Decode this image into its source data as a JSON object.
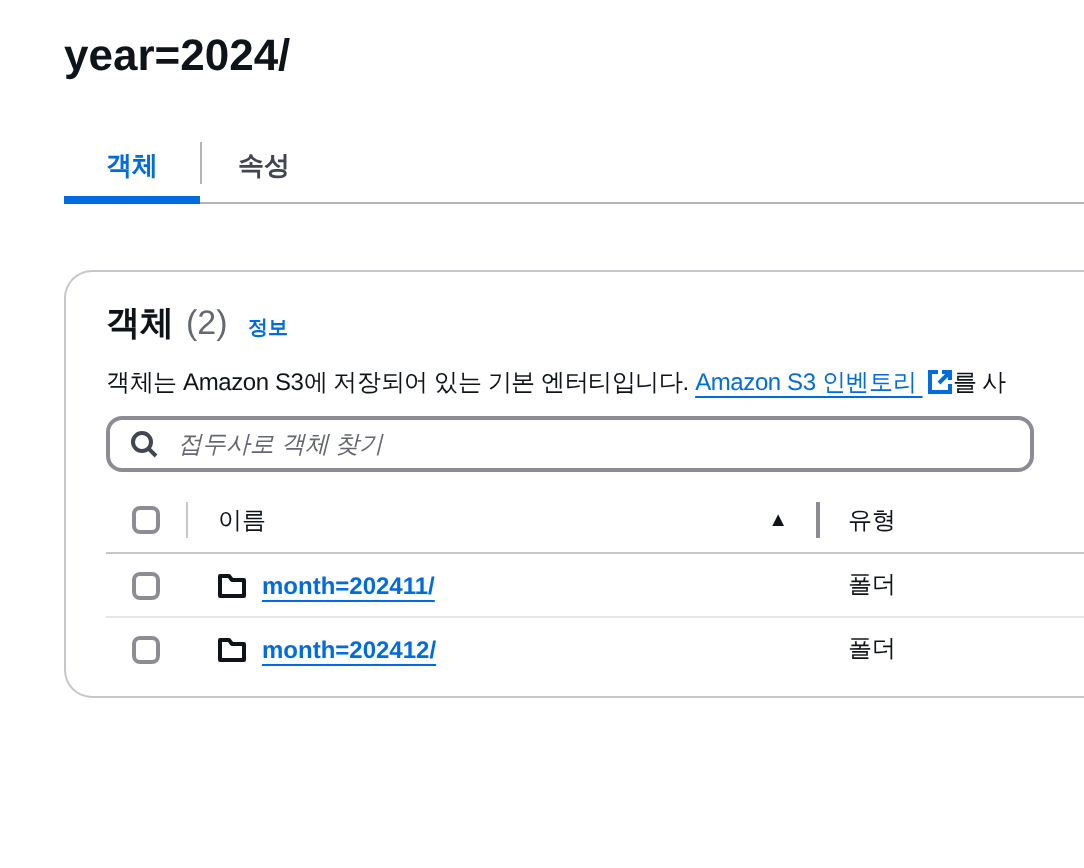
{
  "title": "year=2024/",
  "tabs": [
    {
      "label": "객체",
      "selected": true
    },
    {
      "label": "속성",
      "selected": false
    }
  ],
  "objects_panel": {
    "heading": "객체",
    "count": "(2)",
    "info_link": "정보",
    "description": {
      "text": "객체는 Amazon S3에 저장되어 있는 기본 엔터티입니다.",
      "link": "Amazon S3 인벤토리",
      "after": "를 사"
    },
    "search": {
      "placeholder": "접두사로 객체 찾기"
    },
    "select_all": {
      "checked": false
    },
    "columns": [
      {
        "label": "이름",
        "sort_indicator": "▲"
      },
      {
        "label": "유형"
      }
    ],
    "rows": [
      {
        "name": "month=202411/",
        "type": "폴더",
        "checked": false
      },
      {
        "name": "month=202412/",
        "type": "폴더",
        "checked": false
      }
    ]
  }
}
